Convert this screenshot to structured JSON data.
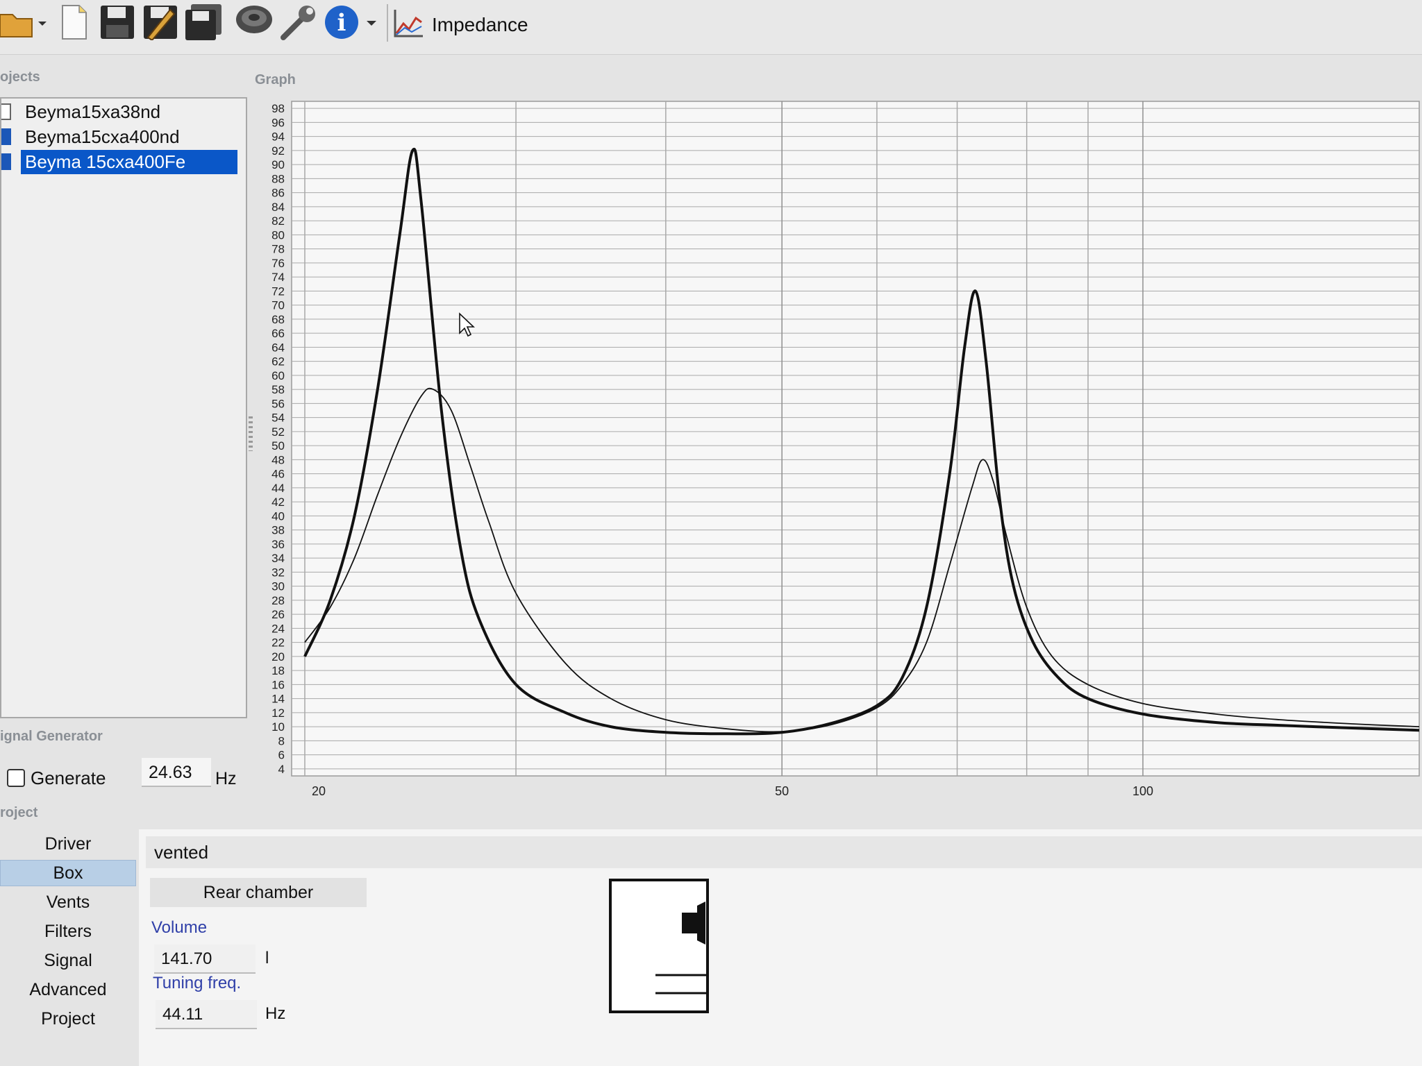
{
  "toolbar": {
    "icons": [
      "folder-open-icon",
      "new-file-icon",
      "save-icon",
      "save-as-icon",
      "save-all-icon",
      "speaker-icon",
      "wrench-icon",
      "info-icon",
      "impedance-graph-icon"
    ],
    "graph_label": "Impedance"
  },
  "projects": {
    "caption": "ojects",
    "items": [
      {
        "label": "Beyma15xa38nd",
        "checked": false,
        "selected": false
      },
      {
        "label": "Beyma15cxa400nd",
        "checked": true,
        "selected": false
      },
      {
        "label": "Beyma 15cxa400Fe",
        "checked": true,
        "selected": true
      }
    ]
  },
  "graph": {
    "caption": "Graph"
  },
  "chart_data": {
    "type": "line",
    "xscale": "log",
    "xlim": [
      19.5,
      170
    ],
    "ylim": [
      3,
      99
    ],
    "y_ticks": [
      4,
      6,
      8,
      10,
      12,
      14,
      16,
      18,
      20,
      22,
      24,
      26,
      28,
      30,
      32,
      34,
      36,
      38,
      40,
      42,
      44,
      46,
      48,
      50,
      52,
      54,
      56,
      58,
      60,
      62,
      64,
      66,
      68,
      70,
      72,
      74,
      76,
      78,
      80,
      82,
      84,
      86,
      88,
      90,
      92,
      94,
      96,
      98
    ],
    "x_tick_labels": [
      {
        "x": 20,
        "label": "20"
      },
      {
        "x": 50,
        "label": "50"
      },
      {
        "x": 100,
        "label": "100"
      }
    ],
    "grid": true,
    "series": [
      {
        "style": "bold",
        "x": [
          20,
          21,
          22,
          23,
          24,
          24.6,
          25,
          26,
          27,
          28,
          30,
          33,
          36,
          40,
          45,
          50,
          55,
          60,
          63,
          66,
          69,
          71,
          72.5,
          74,
          76,
          78,
          81,
          85,
          90,
          100,
          115,
          130,
          150,
          170
        ],
        "y": [
          20,
          28,
          40,
          58,
          80,
          92,
          85,
          55,
          35,
          25,
          16,
          12,
          10,
          9.2,
          9,
          9.2,
          10.5,
          13,
          17,
          27,
          46,
          64,
          72,
          62,
          42,
          30,
          22,
          17,
          14,
          11.8,
          10.6,
          10.2,
          9.8,
          9.5
        ]
      },
      {
        "style": "thin",
        "x": [
          20,
          21,
          22,
          23,
          24,
          25,
          25.6,
          26.5,
          27.5,
          28.5,
          30,
          33,
          36,
          40,
          45,
          50,
          55,
          60,
          63,
          66,
          69,
          72,
          73.5,
          75,
          77,
          80,
          84,
          90,
          100,
          115,
          130,
          150,
          170
        ],
        "y": [
          22,
          27,
          34,
          43,
          51,
          57,
          58,
          55,
          47,
          39,
          29,
          19,
          14,
          11,
          9.7,
          9.3,
          10.3,
          12.7,
          16,
          22,
          33,
          44,
          48,
          45,
          37,
          27,
          20,
          16,
          13.3,
          11.8,
          11,
          10.4,
          10
        ]
      }
    ]
  },
  "signal_generator": {
    "caption": "ignal Generator",
    "generate_label": "Generate",
    "checked": false,
    "frequency": "24.63",
    "unit": "Hz"
  },
  "project_nav": {
    "caption": "roject",
    "items": [
      "Driver",
      "Box",
      "Vents",
      "Filters",
      "Signal",
      "Advanced",
      "Project"
    ],
    "active": "Box"
  },
  "box": {
    "type": "vented",
    "rear_chamber_label": "Rear chamber",
    "volume_label": "Volume",
    "volume_value": "141.70",
    "volume_unit": "l",
    "tuning_label": "Tuning freq.",
    "tuning_value": "44.11",
    "tuning_unit": "Hz"
  }
}
